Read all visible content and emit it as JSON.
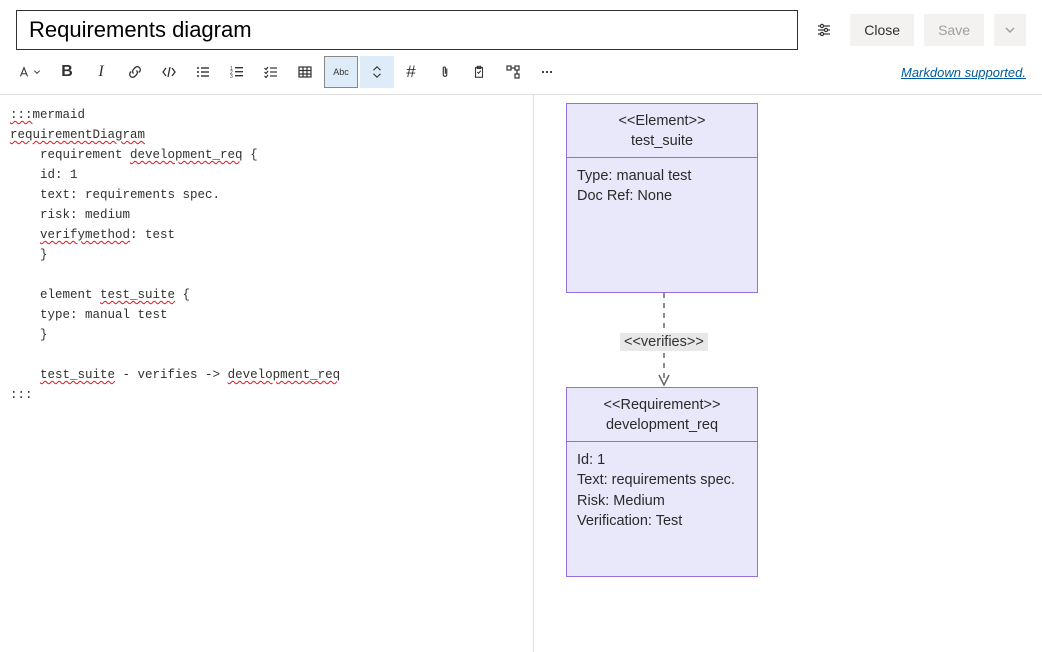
{
  "header": {
    "title": "Requirements diagram",
    "close_label": "Close",
    "save_label": "Save"
  },
  "toolbar": {
    "bold": "B",
    "italic": "I",
    "hash": "#",
    "abc": "Abc",
    "markdown_link": "Markdown supported."
  },
  "editor": {
    "l0a": ":::",
    "l0b": "mermaid",
    "l1": "requirementDiagram",
    "l2a": "    requirement ",
    "l2b": "development_req",
    "l2c": " {",
    "l3": "    id: 1",
    "l4": "    text: requirements spec.",
    "l5": "    risk: medium",
    "l6a": "    ",
    "l6b": "verifymethod",
    "l6c": ": test",
    "l7": "    }",
    "l8": "",
    "l9a": "    element ",
    "l9b": "test_suite",
    "l9c": " {",
    "l10": "    type: manual test",
    "l11": "    }",
    "l12": "",
    "l13a": "    ",
    "l13b": "test_suite",
    "l13c": " - verifies -> ",
    "l13d": "development_req",
    "l14": ":::"
  },
  "diagram": {
    "box1_stereotype": "<<Element>>",
    "box1_name": "test_suite",
    "box1_line1": "Type: manual test",
    "box1_line2": "Doc Ref: None",
    "edge_label": "<<verifies>>",
    "box2_stereotype": "<<Requirement>>",
    "box2_name": "development_req",
    "box2_line1": "Id: 1",
    "box2_line2": "Text: requirements spec.",
    "box2_line3": "Risk: Medium",
    "box2_line4": "Verification: Test"
  }
}
